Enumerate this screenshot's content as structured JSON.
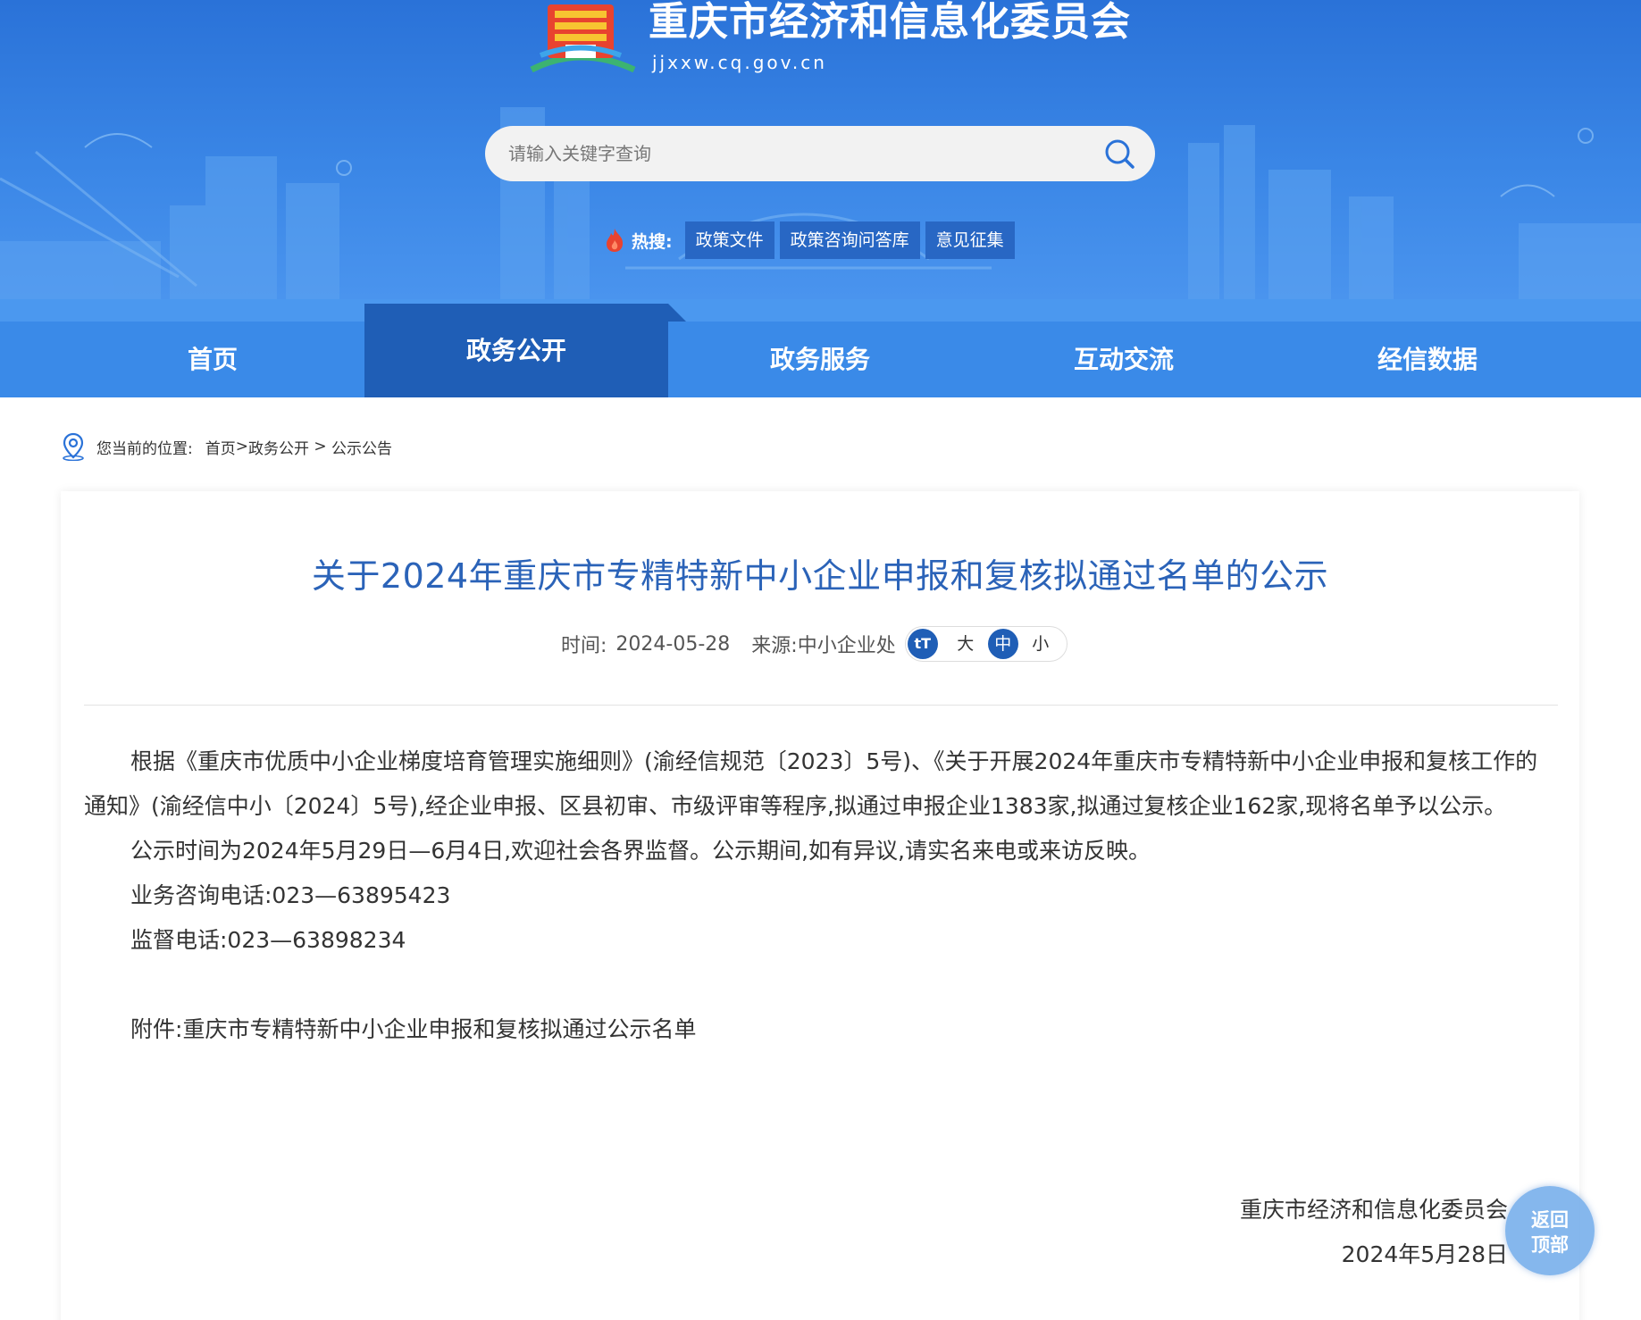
{
  "site": {
    "title": "重庆市经济和信息化委员会",
    "domain": "jjxxw.cq.gov.cn"
  },
  "search": {
    "placeholder": "请输入关键字查询"
  },
  "hot": {
    "label": "热搜:",
    "tags": [
      "政策文件",
      "政策咨询问答库",
      "意见征集"
    ]
  },
  "nav": {
    "items": [
      "首页",
      "政务公开",
      "政务服务",
      "互动交流",
      "经信数据"
    ],
    "active": "政务公开"
  },
  "breadcrumb": {
    "prefix": "您当前的位置:",
    "home": "首页",
    "sep1": ">",
    "section": "政务公开",
    "sep2": " > ",
    "current": "公示公告"
  },
  "article": {
    "title": "关于2024年重庆市专精特新中小企业申报和复核拟通过名单的公示",
    "time_label": "时间:",
    "time": "2024-05-28",
    "source_label": "来源:",
    "source": "中小企业处",
    "font_sizes": [
      "大",
      "中",
      "小"
    ],
    "font_active": "中",
    "paragraph1": "根据《重庆市优质中小企业梯度培育管理实施细则》(渝经信规范〔2023〕5号)、《关于开展2024年重庆市专精特新中小企业申报和复核工作的通知》(渝经信中小〔2024〕5号),经企业申报、区县初审、市级评审等程序,拟通过申报企业1383家,拟通过复核企业162家,现将名单予以公示。",
    "paragraph2": "公示时间为2024年5月29日—6月4日,欢迎社会各界监督。公示期间,如有异议,请实名来电或来访反映。",
    "phone_business": "业务咨询电话:023—63895423",
    "phone_supervise": "监督电话:023—63898234",
    "attachment_label": "附件:",
    "attachment": "重庆市专精特新中小企业申报和复核拟通过公示名单",
    "signature_org": "重庆市经济和信息化委员会",
    "signature_date": "2024年5月28日"
  },
  "back_top": {
    "line1": "返回",
    "line2": "顶部"
  },
  "colors": {
    "header_blue": "#2a72d8",
    "nav_active": "#1f5eb6",
    "title_blue": "#2b63b8"
  }
}
